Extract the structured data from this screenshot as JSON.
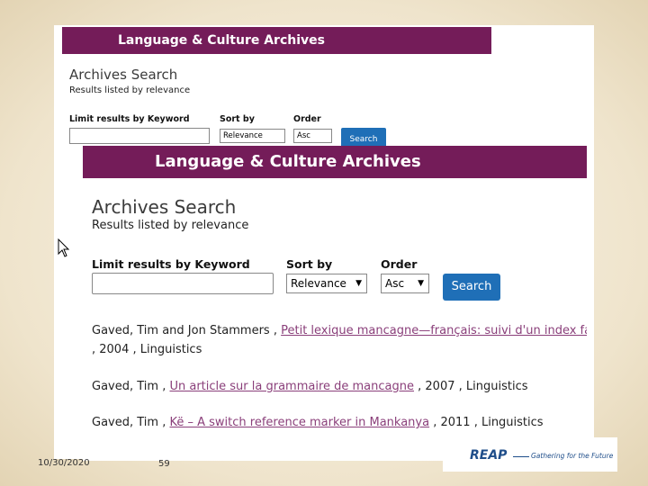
{
  "slide": {
    "date": "10/30/2020",
    "page_number": "59",
    "logo_text": "REAP",
    "logo_tagline": "Gathering for the Future"
  },
  "back_screenshot": {
    "banner": "Language & Culture Archives",
    "title": "Archives Search",
    "subtitle": "Results listed by relevance",
    "keyword_label": "Limit results by Keyword",
    "sort_label": "Sort by",
    "sort_value": "Relevance",
    "order_label": "Order",
    "order_value": "Asc",
    "search_button": "Search"
  },
  "front_screenshot": {
    "banner": "Language & Culture Archives",
    "title": "Archives Search",
    "subtitle": "Results listed by relevance",
    "keyword_label": "Limit results by Keyword",
    "keyword_value": "",
    "sort_label": "Sort by",
    "sort_value": "Relevance",
    "order_label": "Order",
    "order_value": "Asc",
    "search_button": "Search",
    "results": [
      {
        "authors": "Gaved, Tim and Jon Stammers ,",
        "link": "Petit lexique mancagne—français: suivi d'un index fançais—",
        "rest": ", 2004 , Linguistics"
      },
      {
        "authors": "Gaved, Tim ,",
        "link": "Un article sur la grammaire de mancagne",
        "rest": ", 2007 , Linguistics"
      },
      {
        "authors": "Gaved, Tim ,",
        "link": "Kë – A switch reference marker in Mankanya",
        "rest": ", 2011 , Linguistics"
      }
    ]
  }
}
